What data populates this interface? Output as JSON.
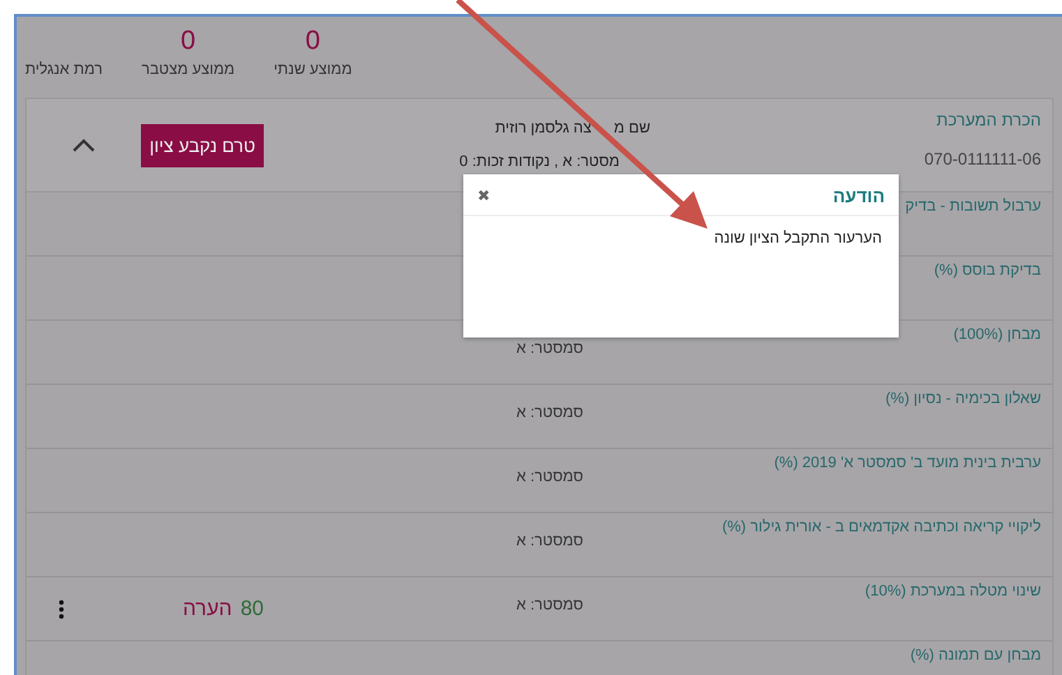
{
  "stats": [
    {
      "label": "ממוצע שנתי",
      "value": "0"
    },
    {
      "label": "ממוצע מצטבר",
      "value": "0"
    },
    {
      "label": "רמת אנגלית"
    }
  ],
  "course": {
    "title": "הכרת המערכת",
    "code": "070-0111111-06",
    "lecturer": [
      "שם מ",
      "צה  גלסמן רוזית"
    ],
    "details": "מסטר: א , נקודות זכות:  0",
    "status_button": "טרם נקבע ציון",
    "expanded": true
  },
  "rows": [
    {
      "name": "ערבול תשובות - בדיק"
    },
    {
      "name": "בדיקת בוסס (%)"
    },
    {
      "name": "מבחן (100%)",
      "semester": "סמסטר: א"
    },
    {
      "name": "שאלון בכימיה - נסיון (%)",
      "semester": "סמסטר: א"
    },
    {
      "name": "ערבית בינית מועד ב' סמסטר א' 2019 (%)",
      "semester": "סמסטר: א"
    },
    {
      "name": "ליקויי קריאה וכתיבה אקדמאים ב - אורית גילור (%)",
      "semester": "סמסטר: א"
    },
    {
      "name": "שינוי מטלה במערכת (10%)",
      "semester": "סמסטר: א",
      "grade": "80",
      "note": "הערה",
      "menu": true
    },
    {
      "name": "מבחן עם תמונה (%)"
    }
  ],
  "dialog": {
    "title": "הודעה",
    "close": "✖",
    "message": "הערעור התקבל הציון שונה"
  }
}
